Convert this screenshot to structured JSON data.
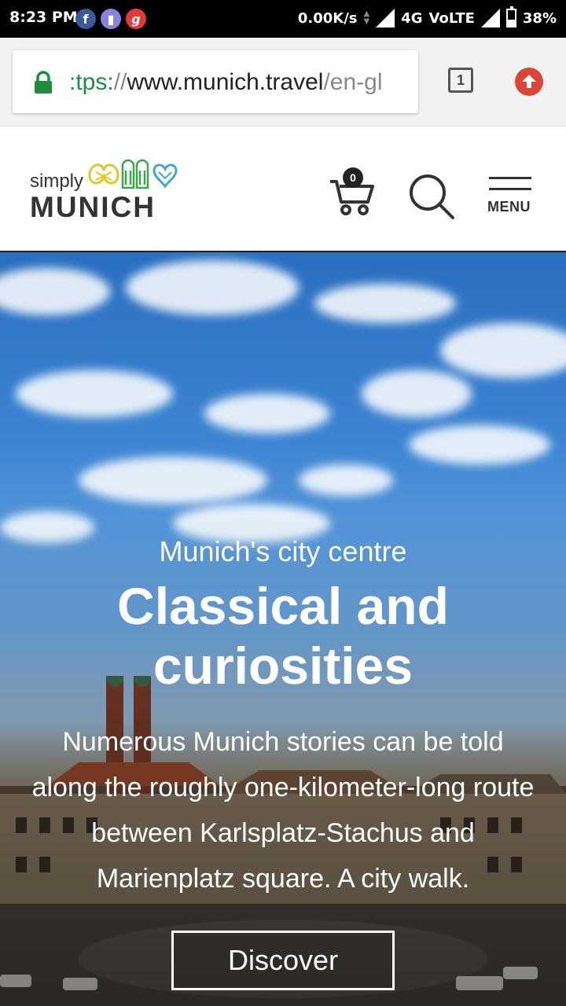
{
  "status_bar": {
    "time": "8:23 PM",
    "net_speed": "0.00K/s",
    "network_type": "4G",
    "volte": "VoLTE",
    "battery": "38%",
    "battery_level": 0.38,
    "notification_icons": [
      "facebook-icon",
      "messenger-icon",
      "gaana-icon"
    ]
  },
  "browser": {
    "url_scheme": ":tps:",
    "url_sep": "//",
    "url_host": "www.munich.travel",
    "url_path": "/en-gl",
    "tab_count": "1",
    "icons": {
      "lock": "lock-icon",
      "tabs": "tabs-icon",
      "update": "update-arrow-icon"
    }
  },
  "site_header": {
    "logo_small": "simply",
    "logo_big": "MUNICH",
    "cart_count": "0",
    "menu_label": "MENU",
    "icons": {
      "cart": "cart-icon",
      "search": "search-icon",
      "menu": "hamburger-icon"
    }
  },
  "hero": {
    "kicker": "Munich's city centre",
    "title": "Classical and curiosities",
    "body": "Numerous Munich stories can be told along the roughly one-kilometer-long route between Karlsplatz-Stachus and Marienplatz square. A city walk.",
    "cta": "Discover"
  },
  "colors": {
    "secure_green": "#1e8e3e",
    "update_red": "#db4437",
    "logo_yellow": "#e8c61e",
    "logo_green": "#3aa84a",
    "logo_blue": "#3fa8d8"
  }
}
